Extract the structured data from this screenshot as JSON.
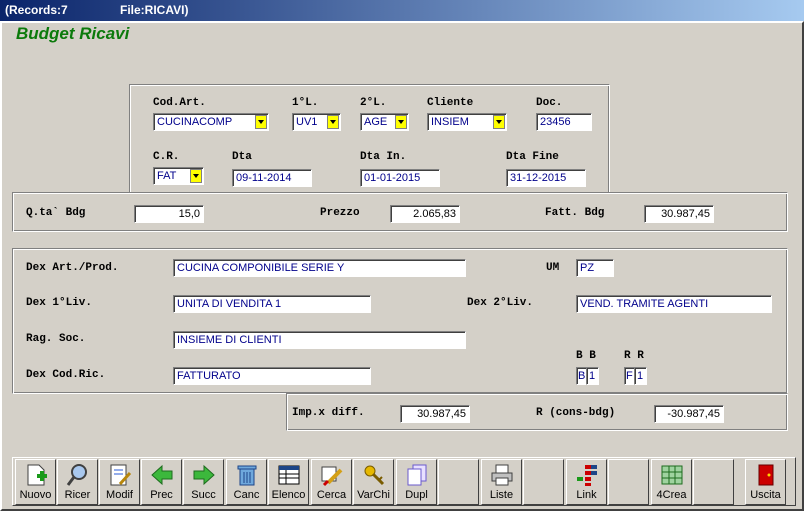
{
  "titlebar": {
    "records": "(Records:7",
    "file": "File:RICAVI)"
  },
  "heading": "Budget Ricavi",
  "keys": {
    "cod_art": {
      "label": "Cod.Art.",
      "value": "CUCINACOMP"
    },
    "liv1": {
      "label": "1°L.",
      "value": "UV1"
    },
    "liv2": {
      "label": "2°L.",
      "value": "AGE"
    },
    "cliente": {
      "label": "Cliente",
      "value": "INSIEM"
    },
    "doc": {
      "label": "Doc.",
      "value": "23456"
    },
    "cr": {
      "label": "C.R.",
      "value": "FAT"
    },
    "dta": {
      "label": "Dta",
      "value": "09-11-2014"
    },
    "dta_in": {
      "label": "Dta In.",
      "value": "01-01-2015"
    },
    "dta_fine": {
      "label": "Dta Fine",
      "value": "31-12-2015"
    }
  },
  "amounts": {
    "qta": {
      "label": "Q.ta` Bdg",
      "value": "15,0"
    },
    "prezzo": {
      "label": "Prezzo",
      "value": "2.065,83"
    },
    "fatt": {
      "label": "Fatt. Bdg",
      "value": "30.987,45"
    }
  },
  "details": {
    "dex_art": {
      "label": "Dex Art./Prod.",
      "value": "CUCINA COMPONIBILE SERIE Y"
    },
    "um": {
      "label": "UM",
      "value": "PZ"
    },
    "dex1": {
      "label": "Dex 1°Liv.",
      "value": "UNITA DI VENDITA 1"
    },
    "dex2": {
      "label": "Dex 2°Liv.",
      "value": "VEND. TRAMITE AGENTI"
    },
    "rag_soc": {
      "label": "Rag. Soc.",
      "value": "INSIEME DI CLIENTI"
    },
    "dex_codric": {
      "label": "Dex Cod.Ric.",
      "value": "FATTURATO"
    },
    "bb": {
      "label": "B B",
      "left": "B",
      "right": "1"
    },
    "rr": {
      "label": "R R",
      "left": "F",
      "right": "1"
    }
  },
  "totals": {
    "imp": {
      "label": "Imp.x diff.",
      "value": "30.987,45"
    },
    "r": {
      "label": "R (cons-bdg)",
      "value": "-30.987,45"
    }
  },
  "toolbar": {
    "nuovo": "Nuovo",
    "ricer": "Ricer",
    "modif": "Modif",
    "prec": "Prec",
    "succ": "Succ",
    "canc": "Canc",
    "elenco": "Elenco",
    "cerca": "Cerca",
    "varchi": "VarChi",
    "dupl": "Dupl",
    "liste": "Liste",
    "link": "Link",
    "crea4": "4Crea",
    "uscita": "Uscita"
  },
  "colors": {
    "heading": "#0b7a0b",
    "field_text": "#00008b",
    "combo_arrow": "#ffff00",
    "title_start": "#0a246a"
  }
}
